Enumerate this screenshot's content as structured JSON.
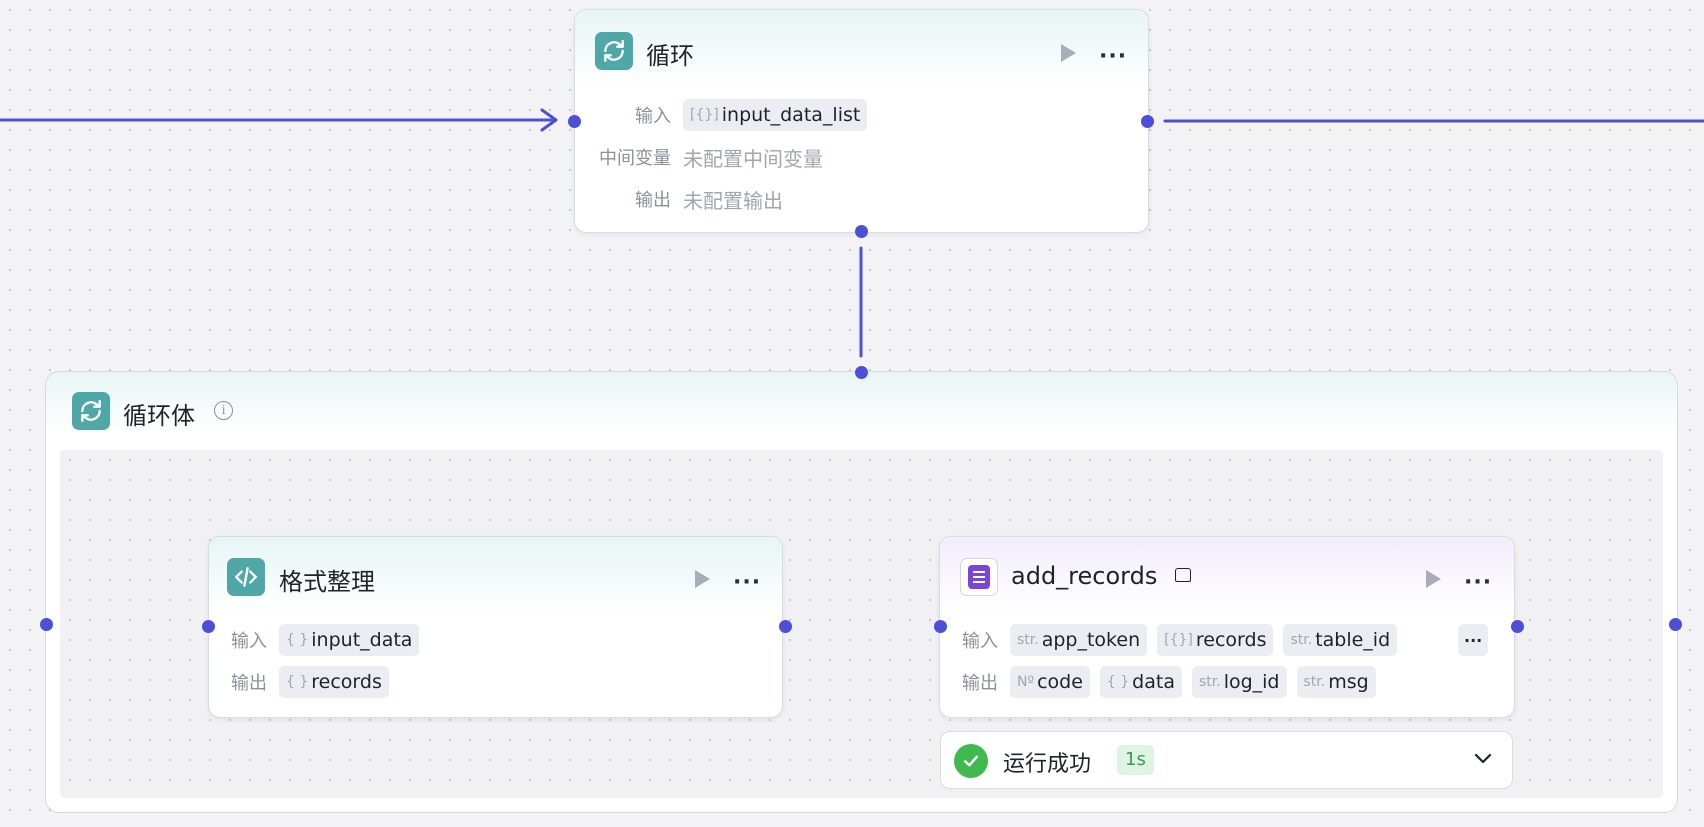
{
  "loop_node": {
    "title": "循环",
    "input_label": "输入",
    "input_type": "[{}]",
    "input_value": "input_data_list",
    "mid_label": "中间变量",
    "mid_value": "未配置中间变量",
    "output_label": "输出",
    "output_value": "未配置输出"
  },
  "loop_body": {
    "title": "循环体"
  },
  "format_node": {
    "title": "格式整理",
    "input_label": "输入",
    "input_type": "{ }",
    "input_value": "input_data",
    "output_label": "输出",
    "output_type": "{ }",
    "output_value": "records"
  },
  "add_records_node": {
    "title": "add_records",
    "input_label": "输入",
    "inputs": [
      {
        "type": "str.",
        "name": "app_token"
      },
      {
        "type": "[{}]",
        "name": "records"
      },
      {
        "type": "str.",
        "name": "table_id"
      }
    ],
    "output_label": "输出",
    "outputs": [
      {
        "type": "Nº",
        "name": "code"
      },
      {
        "type": "{ }",
        "name": "data"
      },
      {
        "type": "str.",
        "name": "log_id"
      },
      {
        "type": "str.",
        "name": "msg"
      }
    ],
    "more_label": "···"
  },
  "run_status": {
    "text": "运行成功",
    "duration": "1s"
  },
  "colors": {
    "edge": "#4c4fd8",
    "teal_icon": "#4fa8a6",
    "purple_icon": "#7b45d9",
    "success": "#3fb950"
  }
}
